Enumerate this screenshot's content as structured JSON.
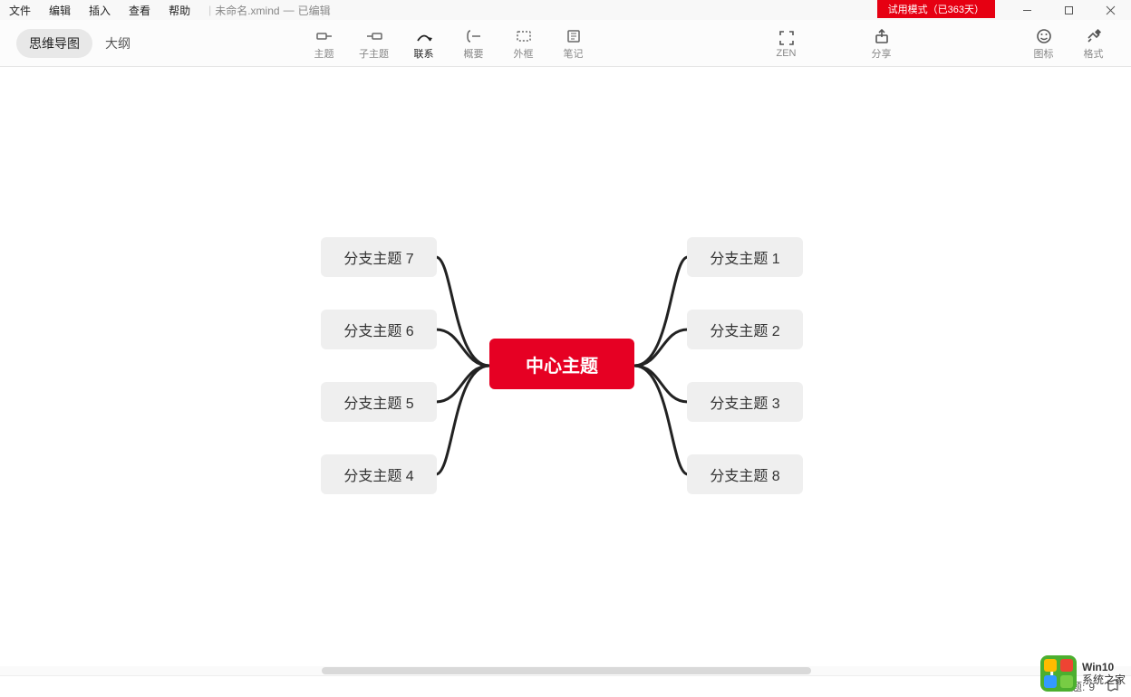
{
  "menubar": {
    "items": [
      "文件",
      "编辑",
      "插入",
      "查看",
      "帮助"
    ]
  },
  "doc": {
    "filename": "未命名.xmind",
    "status": "已编辑"
  },
  "trial": {
    "label": "试用模式（已363天）"
  },
  "view_tabs": {
    "mindmap": "思维导图",
    "outline": "大纲"
  },
  "tools": {
    "topic": "主题",
    "subtopic": "子主题",
    "relationship": "联系",
    "summary": "概要",
    "boundary": "外框",
    "note": "笔记",
    "zen": "ZEN",
    "share": "分享",
    "icons": "图标",
    "format": "格式"
  },
  "mindmap": {
    "center": "中心主题",
    "branches_left": [
      "分支主题 7",
      "分支主题 6",
      "分支主题 5",
      "分支主题 4"
    ],
    "branches_right": [
      "分支主题 1",
      "分支主题 2",
      "分支主题 3",
      "分支主题 8"
    ]
  },
  "status": {
    "topic_label": "主题:",
    "topic_count": "9"
  },
  "watermark": {
    "line1": "Win10",
    "line2": "系统之家"
  }
}
